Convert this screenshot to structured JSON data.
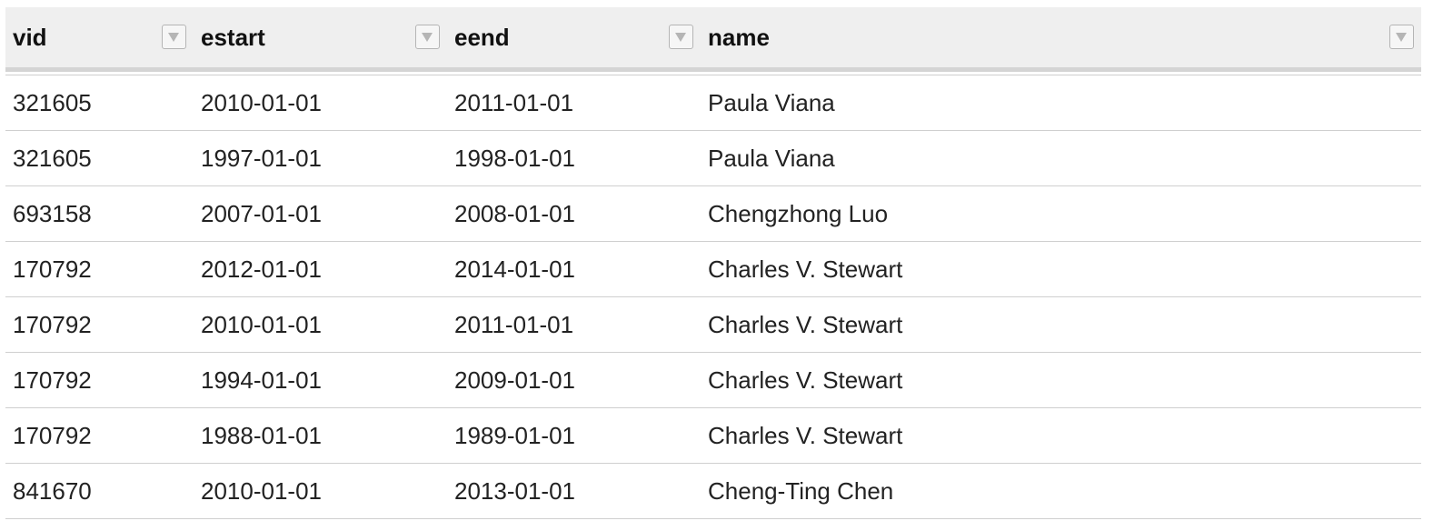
{
  "table": {
    "columns": [
      {
        "key": "vid",
        "label": "vid",
        "filter_icon": "triangle-down-icon"
      },
      {
        "key": "estart",
        "label": "estart",
        "filter_icon": "triangle-down-icon"
      },
      {
        "key": "eend",
        "label": "eend",
        "filter_icon": "triangle-down-icon"
      },
      {
        "key": "name",
        "label": "name",
        "filter_icon": "triangle-down-icon"
      }
    ],
    "rows": [
      [
        "321605",
        "2010-01-01",
        "2011-01-01",
        "Paula Viana"
      ],
      [
        "321605",
        "1997-01-01",
        "1998-01-01",
        "Paula Viana"
      ],
      [
        "693158",
        "2007-01-01",
        "2008-01-01",
        "Chengzhong Luo"
      ],
      [
        "170792",
        "2012-01-01",
        "2014-01-01",
        "Charles V. Stewart"
      ],
      [
        "170792",
        "2010-01-01",
        "2011-01-01",
        "Charles V. Stewart"
      ],
      [
        "170792",
        "1994-01-01",
        "2009-01-01",
        "Charles V. Stewart"
      ],
      [
        "170792",
        "1988-01-01",
        "1989-01-01",
        "Charles V. Stewart"
      ],
      [
        "841670",
        "2010-01-01",
        "2013-01-01",
        "Cheng-Ting Chen"
      ]
    ]
  },
  "colors": {
    "header_bg": "#efefef",
    "row_border": "#cfcfcf",
    "filter_icon": "#b5b5b5"
  }
}
